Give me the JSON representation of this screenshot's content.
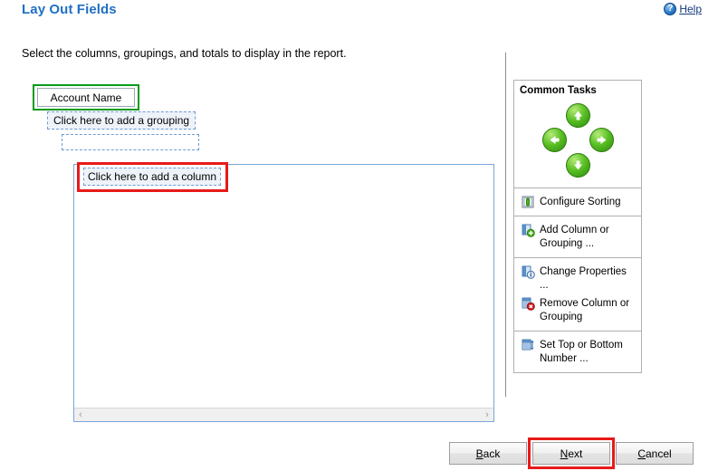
{
  "header": {
    "title": "Lay Out Fields",
    "help_label": "Help",
    "help_icon": "help-question-circle-icon",
    "help_accel": "H"
  },
  "instruction": "Select the columns, groupings, and totals to display in the report.",
  "layout": {
    "account_name_cell": "Account Name",
    "add_grouping_slot": "Click here to add a grouping",
    "empty_grouping_slot": "",
    "add_column_slot": "Click here to add a column",
    "scrollbar": {
      "left_arrow": "‹",
      "right_arrow": "›"
    },
    "highlights": {
      "account_name_color": "#0a9b1b",
      "add_column_color": "#e81a1a"
    }
  },
  "tasks_panel": {
    "heading": "Common Tasks",
    "nav_buttons": [
      {
        "name": "move-up",
        "icon": "arrow-up-icon"
      },
      {
        "name": "move-left",
        "icon": "arrow-left-icon"
      },
      {
        "name": "move-right",
        "icon": "arrow-right-icon"
      },
      {
        "name": "move-down",
        "icon": "arrow-down-icon"
      }
    ],
    "groups": [
      {
        "items": [
          {
            "label": "Configure Sorting",
            "icon": "configure-sorting-icon"
          }
        ]
      },
      {
        "items": [
          {
            "label": "Add Column or Grouping ...",
            "icon": "add-column-icon"
          }
        ]
      },
      {
        "items": [
          {
            "label": "Change Properties ...",
            "icon": "change-properties-icon"
          },
          {
            "label": "Remove Column or Grouping",
            "icon": "remove-column-icon"
          }
        ]
      },
      {
        "items": [
          {
            "label": "Set Top or Bottom Number ...",
            "icon": "set-top-bottom-icon"
          }
        ]
      }
    ]
  },
  "footer": {
    "back": {
      "accel": "B",
      "rest": "ack"
    },
    "next": {
      "accel": "N",
      "rest": "ext"
    },
    "cancel": {
      "accel": "C",
      "rest": "ancel"
    },
    "next_highlight_color": "#e81a1a"
  }
}
